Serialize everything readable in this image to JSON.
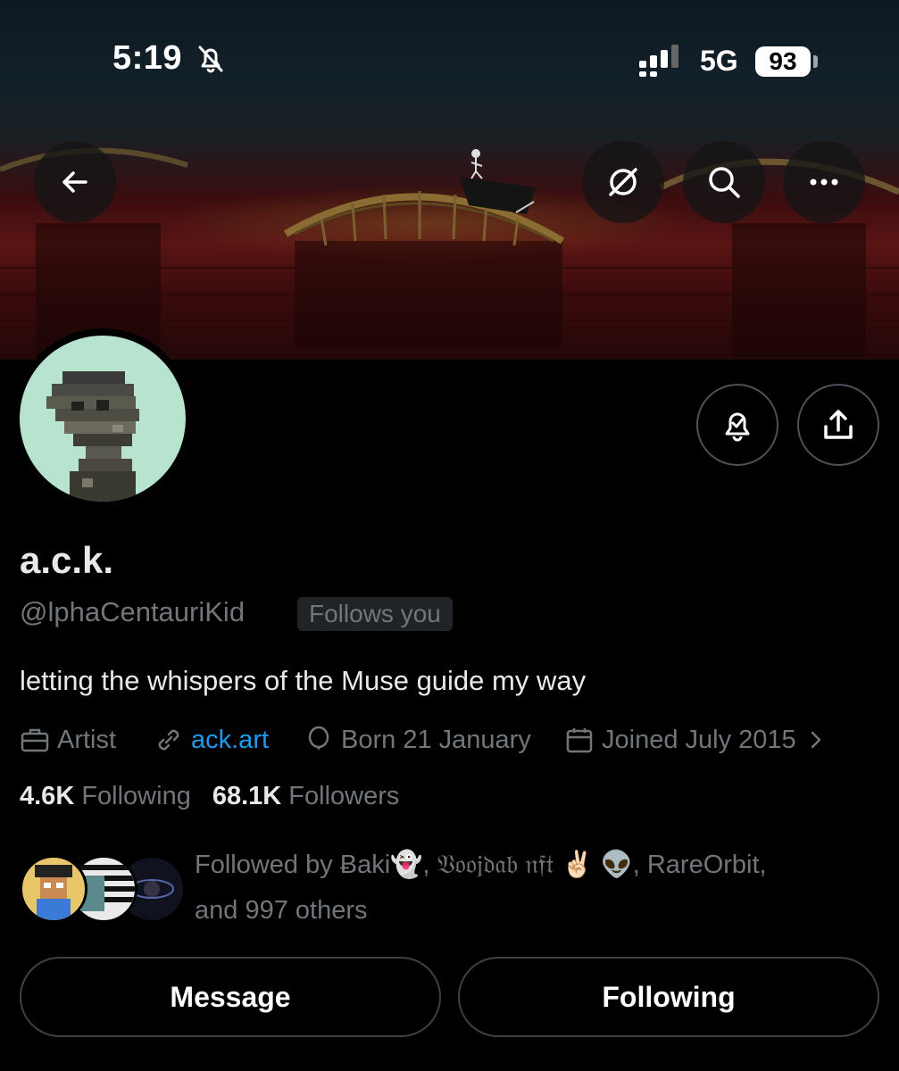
{
  "status_bar": {
    "time": "5:19",
    "network": "5G",
    "battery": "93"
  },
  "profile": {
    "display_name": "a.c.k.",
    "handle": "@lphaCentauriKid",
    "follows_you": "Follows you",
    "bio": "letting the whispers of the Muse guide my way",
    "category": "Artist",
    "website": "ack.art",
    "birthday": "Born 21 January",
    "joined": "Joined July 2015"
  },
  "stats": {
    "following_count": "4.6K",
    "following_label": "Following",
    "followers_count": "68.1K",
    "followers_label": "Followers"
  },
  "followed_by": {
    "line1": "Followed by Ƀaki👻, 𝔙𝔬𝔬𝔧𝔡𝔞𝔟 𝔫𝔣𝔱 ✌🏻 👽, RareOrbit,",
    "line2": "and 997 others"
  },
  "actions": {
    "message": "Message",
    "following": "Following"
  },
  "colors": {
    "background": "#000000",
    "link": "#1d9bf0",
    "muted": "#71767b",
    "avatar_bg": "#b7e3cf"
  },
  "icons": {
    "back": "arrow-left-icon",
    "grok": "grok-icon",
    "search": "search-icon",
    "more": "more-icon",
    "notify": "bell-check-icon",
    "share": "share-icon"
  }
}
